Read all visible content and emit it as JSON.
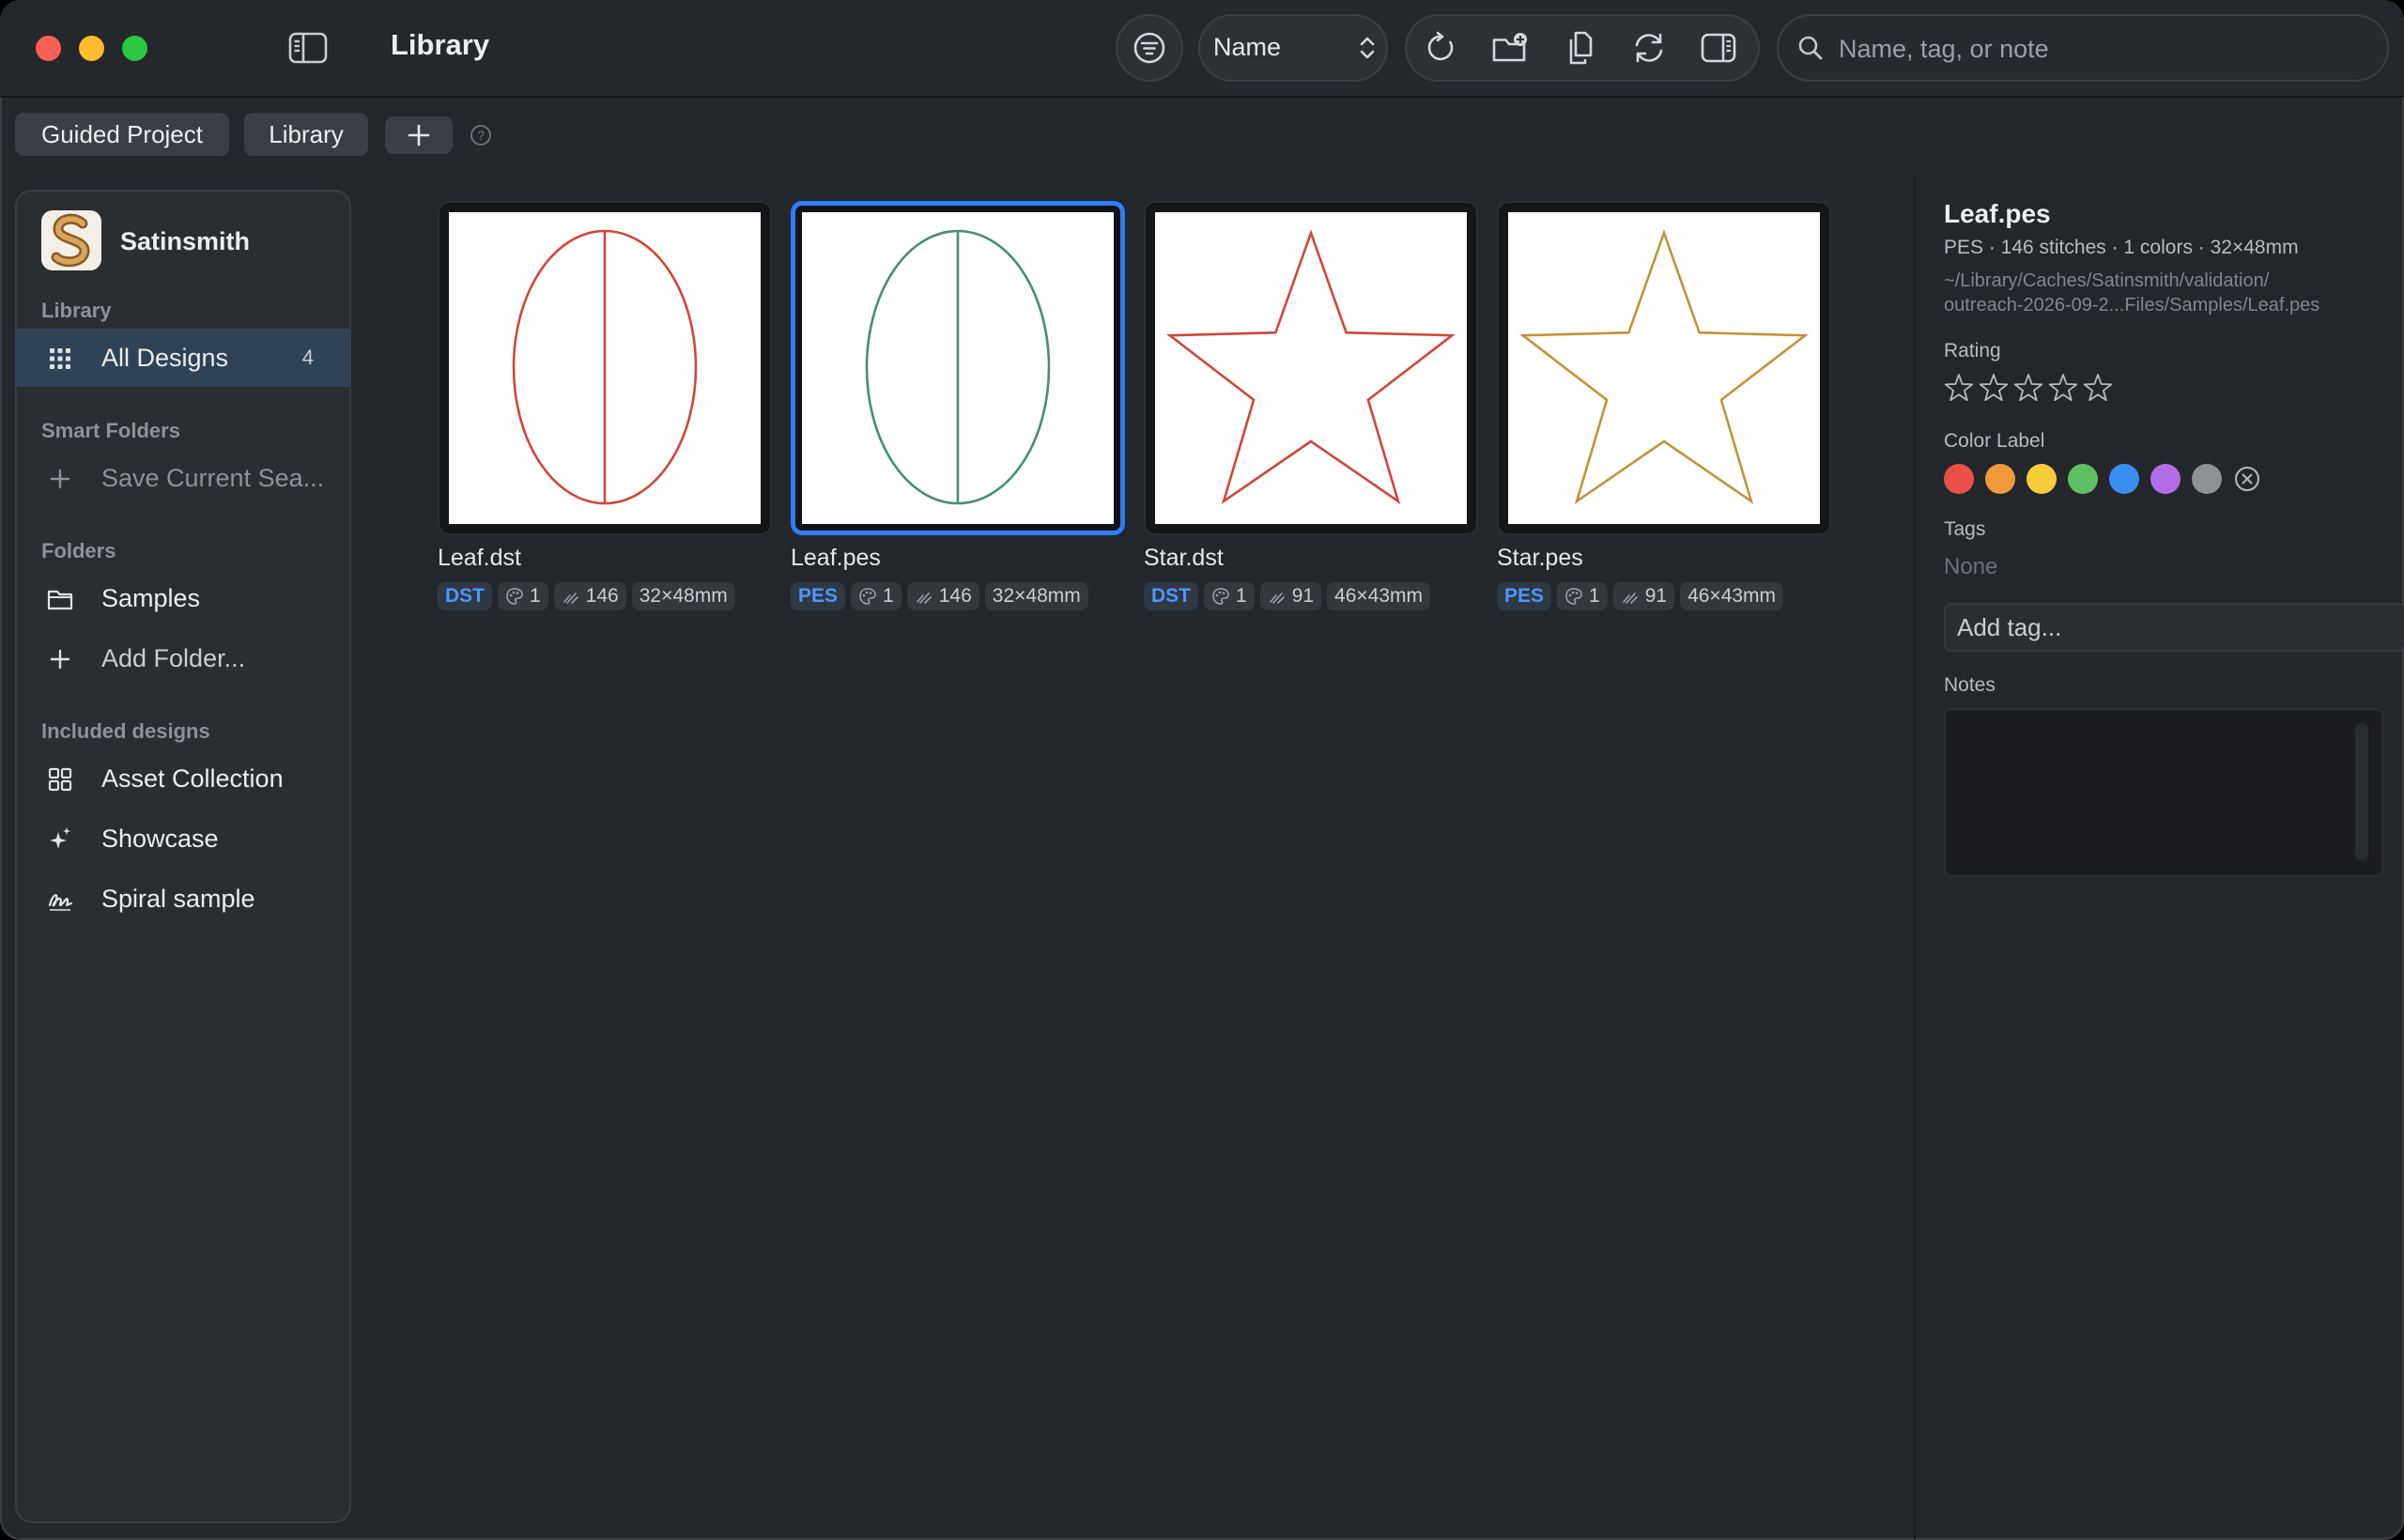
{
  "window": {
    "title": "Library"
  },
  "toolbar": {
    "sort_value": "Name",
    "search_placeholder": "Name, tag, or note"
  },
  "tabs": [
    {
      "label": "Guided Project"
    },
    {
      "label": "Library"
    },
    {
      "label": "+"
    }
  ],
  "sidebar": {
    "app_name": "Satinsmith",
    "sections": {
      "library": "Library",
      "smart_folders": "Smart Folders",
      "folders": "Folders",
      "included": "Included designs"
    },
    "all_designs": {
      "label": "All Designs",
      "count": "4"
    },
    "save_search": "Save Current Sea...",
    "samples": "Samples",
    "add_folder": "Add Folder...",
    "asset_collection": "Asset Collection",
    "showcase": "Showcase",
    "spiral_sample": "Spiral sample"
  },
  "designs": [
    {
      "name": "Leaf.dst",
      "format": "DST",
      "colors": "1",
      "stitches": "146",
      "size": "32×48mm",
      "shape": "leaf",
      "thread_color": "#d0473a",
      "selected": false
    },
    {
      "name": "Leaf.pes",
      "format": "PES",
      "colors": "1",
      "stitches": "146",
      "size": "32×48mm",
      "shape": "leaf",
      "thread_color": "#4a8c78",
      "selected": true
    },
    {
      "name": "Star.dst",
      "format": "DST",
      "colors": "1",
      "stitches": "91",
      "size": "46×43mm",
      "shape": "star",
      "thread_color": "#d0473a",
      "selected": false
    },
    {
      "name": "Star.pes",
      "format": "PES",
      "colors": "1",
      "stitches": "91",
      "size": "46×43mm",
      "shape": "star",
      "thread_color": "#c4933a",
      "selected": false
    }
  ],
  "inspector": {
    "title": "Leaf.pes",
    "meta": "PES · 146 stitches · 1 colors · 32×48mm",
    "path_line1": "~/Library/Caches/Satinsmith/validation/",
    "path_line2": "outreach-2026-09-2...Files/Samples/Leaf.pes",
    "rating_label": "Rating",
    "rating_value": 0,
    "rating_max": 5,
    "color_label_title": "Color Label",
    "color_labels": [
      "#ec4f4a",
      "#f09a3a",
      "#f5cc3a",
      "#5ec062",
      "#3b8ef0",
      "#b26ee6",
      "#8e9296"
    ],
    "tags_label": "Tags",
    "tags_value": "None",
    "add_tag_placeholder": "Add tag...",
    "notes_label": "Notes"
  },
  "theme": {
    "accent": "#2f7cf6",
    "window_bg": "#23272b",
    "sidebar_active": "#2f4358"
  }
}
